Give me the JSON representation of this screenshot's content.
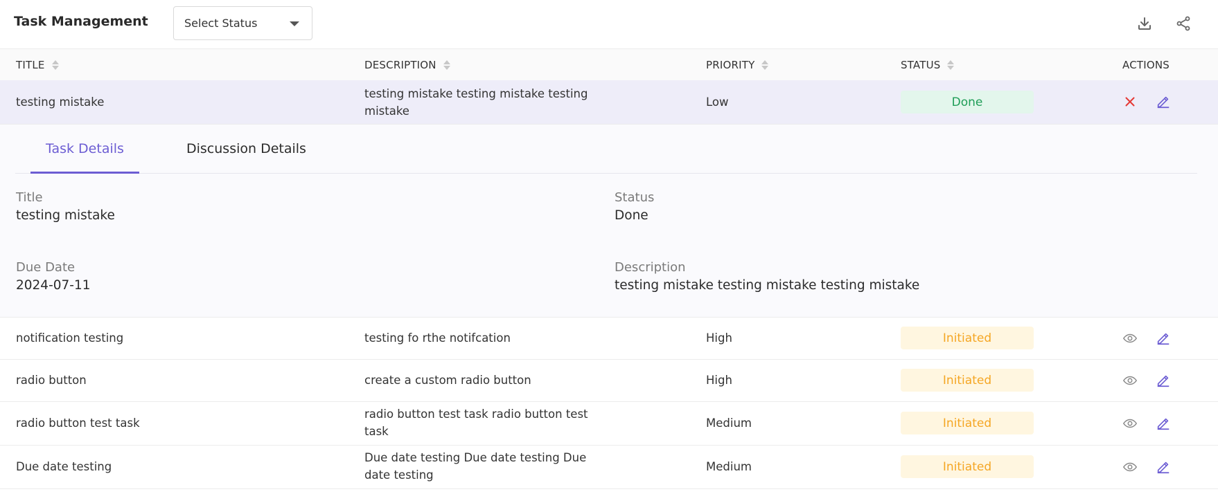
{
  "header": {
    "title": "Task Management",
    "status_filter": {
      "placeholder": "Select Status"
    },
    "icons": {
      "download": "download-icon",
      "share": "share-icon"
    }
  },
  "table": {
    "columns": [
      "TITLE",
      "DESCRIPTION",
      "PRIORITY",
      "STATUS",
      "ACTIONS"
    ],
    "rows": [
      {
        "title": "testing mistake",
        "description": "testing mistake testing mistake testing mistake",
        "priority": "Low",
        "status": "Done"
      },
      {
        "title": "notification testing",
        "description": "testing fo rthe notifcation",
        "priority": "High",
        "status": "Initiated"
      },
      {
        "title": "radio button",
        "description": "create a custom radio button",
        "priority": "High",
        "status": "Initiated"
      },
      {
        "title": "radio button test task",
        "description": "radio button test task radio button test task",
        "priority": "Medium",
        "status": "Initiated"
      },
      {
        "title": "Due date testing",
        "description": "Due date testing Due date testing Due date testing",
        "priority": "Medium",
        "status": "Initiated"
      }
    ]
  },
  "details": {
    "tabs": [
      "Task Details",
      "Discussion Details"
    ],
    "active_tab": "Task Details",
    "fields": {
      "title_label": "Title",
      "title_value": "testing mistake",
      "status_label": "Status",
      "status_value": "Done",
      "due_label": "Due Date",
      "due_value": "2024-07-11",
      "desc_label": "Description",
      "desc_value": "testing mistake testing mistake testing mistake"
    }
  },
  "colors": {
    "accent": "#6c5dd3",
    "done_text": "#1f9d57",
    "done_bg": "#e3f6ec",
    "initiated_text": "#f5a623",
    "initiated_bg": "#fff6e0",
    "delete": "#e53935",
    "selected_row": "#eeedf9"
  }
}
